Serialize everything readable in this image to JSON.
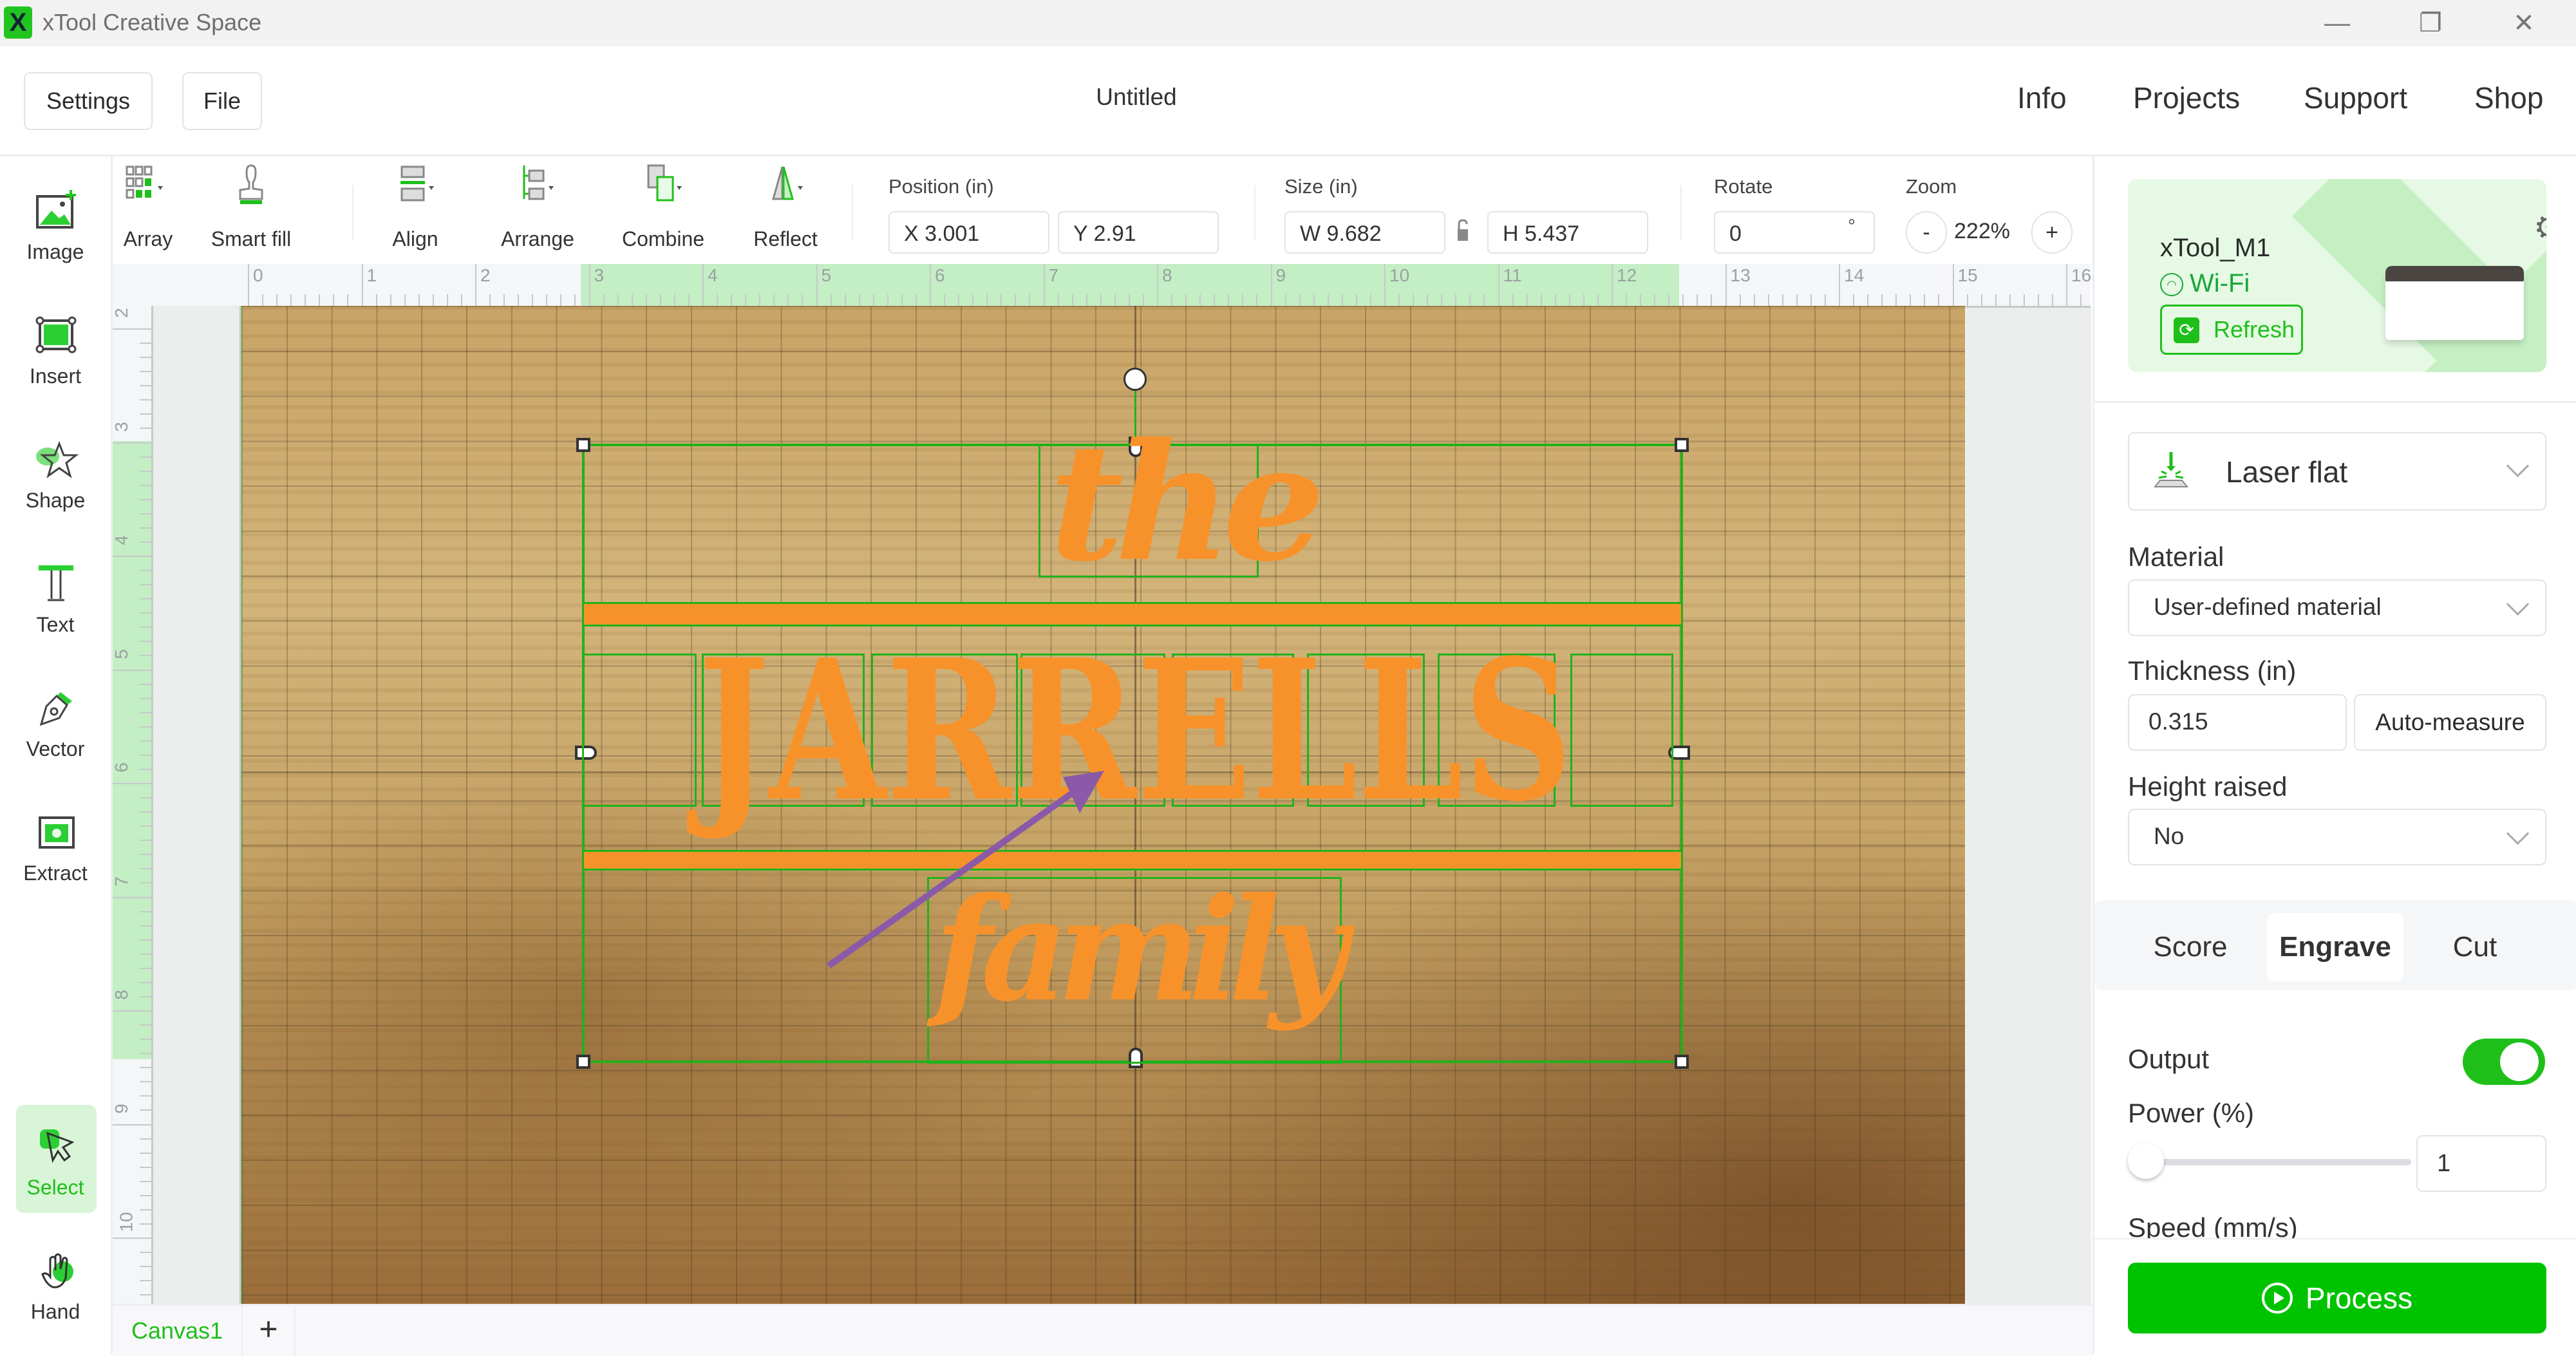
{
  "app": {
    "title": "xTool Creative Space",
    "logo": "X",
    "window_controls": {
      "minimize": "—",
      "restore": "❐",
      "close": "✕"
    }
  },
  "header": {
    "settings_label": "Settings",
    "file_label": "File",
    "doc_title": "Untitled",
    "links": [
      "Info",
      "Projects",
      "Support",
      "Shop"
    ]
  },
  "left_tools": [
    {
      "label": "Image",
      "icon": "image-add-icon"
    },
    {
      "label": "Insert",
      "icon": "insert-icon"
    },
    {
      "label": "Shape",
      "icon": "shape-star-icon"
    },
    {
      "label": "Text",
      "icon": "text-icon"
    },
    {
      "label": "Vector",
      "icon": "pen-icon"
    },
    {
      "label": "Extract",
      "icon": "extract-icon"
    },
    {
      "label": "Select",
      "icon": "cursor-icon",
      "active": true
    },
    {
      "label": "Hand",
      "icon": "hand-icon"
    }
  ],
  "toolbar": {
    "tools": [
      {
        "label": "Array",
        "icon": "array-icon"
      },
      {
        "label": "Smart fill",
        "icon": "smart-fill-icon"
      },
      {
        "label": "Align",
        "icon": "align-icon"
      },
      {
        "label": "Arrange",
        "icon": "arrange-icon"
      },
      {
        "label": "Combine",
        "icon": "combine-icon"
      },
      {
        "label": "Reflect",
        "icon": "reflect-icon"
      }
    ],
    "position_label": "Position (in)",
    "x_value": "X 3.001",
    "y_value": "Y 2.91",
    "size_label": "Size (in)",
    "w_value": "W 9.682",
    "h_value": "H 5.437",
    "rotate_label": "Rotate",
    "rotate_value": "0",
    "rotate_unit": "°",
    "zoom_label": "Zoom",
    "zoom_minus": "-",
    "zoom_value": "222%",
    "zoom_plus": "+"
  },
  "rulers": {
    "horizontal": [
      "0",
      "1",
      "2",
      "3",
      "4",
      "5",
      "6",
      "7",
      "8",
      "9",
      "10",
      "11",
      "12",
      "13",
      "14",
      "15",
      "16"
    ],
    "vertical": [
      "2",
      "3",
      "4",
      "5",
      "6",
      "7",
      "8",
      "9",
      "10"
    ]
  },
  "design": {
    "top_word": "the",
    "main_word": "JARRELLS",
    "bottom_word": "family",
    "fill_color": "#f7922a",
    "selection_color": "#21b21b",
    "annotation_arrow_color": "#8a5aa8"
  },
  "canvas_tabs": {
    "active": "Canvas1",
    "add": "+"
  },
  "right_panel": {
    "device": {
      "name": "xTool_M1",
      "connection": "Wi-Fi",
      "refresh_label": "Refresh"
    },
    "mode": "Laser flat",
    "material_label": "Material",
    "material_value": "User-defined material",
    "thickness_label": "Thickness (in)",
    "thickness_value": "0.315",
    "auto_measure_label": "Auto-measure",
    "height_raised_label": "Height raised",
    "height_raised_value": "No",
    "process_tabs": [
      "Score",
      "Engrave",
      "Cut"
    ],
    "active_tab": "Engrave",
    "output_label": "Output",
    "output_on": true,
    "power_label": "Power (%)",
    "power_value": "1",
    "power_percent": 1,
    "speed_label": "Speed (mm/s)",
    "process_label": "Process",
    "accent_color": "#00c300"
  }
}
